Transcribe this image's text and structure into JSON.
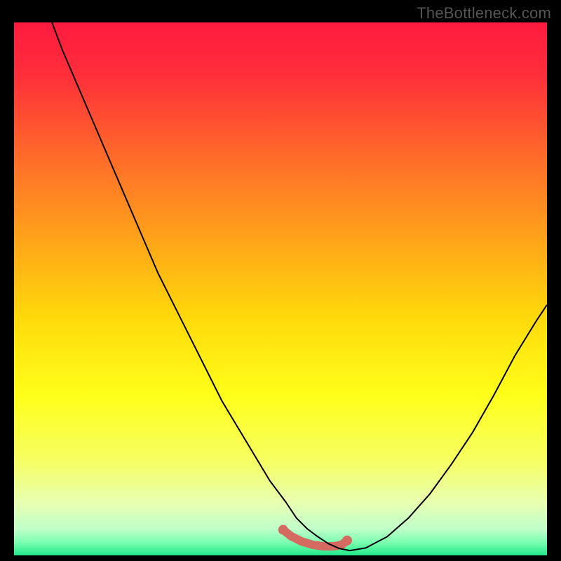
{
  "watermark": "TheBottleneck.com",
  "chart_data": {
    "type": "line",
    "title": "",
    "xlabel": "",
    "ylabel": "",
    "xlim": [
      0,
      100
    ],
    "ylim": [
      0,
      100
    ],
    "grid": false,
    "legend": false,
    "gradient_stops": [
      {
        "offset": 0.0,
        "color": "#ff1a3f"
      },
      {
        "offset": 0.1,
        "color": "#ff2f3a"
      },
      {
        "offset": 0.25,
        "color": "#ff6a2a"
      },
      {
        "offset": 0.4,
        "color": "#ffa11a"
      },
      {
        "offset": 0.55,
        "color": "#ffd80a"
      },
      {
        "offset": 0.7,
        "color": "#ffff1a"
      },
      {
        "offset": 0.82,
        "color": "#f6ff60"
      },
      {
        "offset": 0.9,
        "color": "#e8ffb0"
      },
      {
        "offset": 0.95,
        "color": "#c0ffca"
      },
      {
        "offset": 0.975,
        "color": "#7dffb0"
      },
      {
        "offset": 1.0,
        "color": "#20e88a"
      }
    ],
    "series": [
      {
        "name": "main-curve",
        "color": "#000000",
        "width": 2,
        "x": [
          0,
          3,
          6,
          9,
          12,
          15,
          18,
          21,
          24,
          27,
          30,
          33,
          36,
          39,
          42,
          45,
          48,
          51,
          53,
          55,
          57,
          59,
          61,
          63,
          66,
          70,
          74,
          78,
          82,
          86,
          90,
          94,
          98,
          100
        ],
        "y": [
          123,
          112,
          103,
          95,
          88,
          81,
          74,
          67,
          60,
          53,
          47,
          41,
          35,
          29,
          24,
          19,
          14,
          10,
          7,
          5,
          3.5,
          2.2,
          1.3,
          0.9,
          1.4,
          3.5,
          7.0,
          11.5,
          17.0,
          23.0,
          30.0,
          37.5,
          44.0,
          47.0
        ]
      },
      {
        "name": "highlight-band",
        "color": "#d46a62",
        "width": 12,
        "cap": "round",
        "x": [
          50.5,
          52,
          54,
          56,
          58,
          60,
          61.5,
          62.5
        ],
        "y": [
          4.8,
          3.6,
          2.6,
          2.0,
          1.7,
          1.7,
          2.0,
          2.8
        ]
      }
    ],
    "highlight_dots": {
      "color": "#d46a62",
      "radius": 7,
      "points": [
        {
          "x": 50.5,
          "y": 4.8
        },
        {
          "x": 62.5,
          "y": 2.8
        }
      ]
    }
  }
}
